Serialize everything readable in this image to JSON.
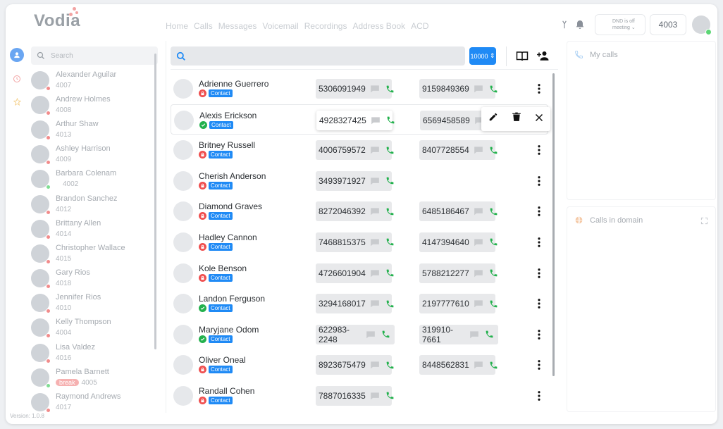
{
  "app": {
    "logo": "Vodia",
    "version": "Version: 1.0.8"
  },
  "nav": [
    "Home",
    "Calls",
    "Messages",
    "Voicemail",
    "Recordings",
    "Address Book",
    "ACD"
  ],
  "header": {
    "dnd_status": "DND is off",
    "dnd_mode": "meeting",
    "extension": "4003"
  },
  "sidebar": {
    "search_placeholder": "Search",
    "users": [
      {
        "name": "Alexander Aguilar",
        "ext": "4007",
        "status": "red"
      },
      {
        "name": "Andrew Holmes",
        "ext": "4008",
        "status": "red"
      },
      {
        "name": "Arthur Shaw",
        "ext": "4013",
        "status": "red"
      },
      {
        "name": "Ashley Harrison",
        "ext": "4009",
        "status": "red"
      },
      {
        "name": "Barbara Colenam",
        "ext": "4002",
        "status": "green"
      },
      {
        "name": "Brandon Sanchez",
        "ext": "4012",
        "status": "red"
      },
      {
        "name": "Brittany Allen",
        "ext": "4014",
        "status": "red"
      },
      {
        "name": "Christopher Wallace",
        "ext": "4015",
        "status": "red"
      },
      {
        "name": "Gary Rios",
        "ext": "4018",
        "status": "red"
      },
      {
        "name": "Jennifer Rios",
        "ext": "4010",
        "status": "red"
      },
      {
        "name": "Kelly Thompson",
        "ext": "4004",
        "status": "red"
      },
      {
        "name": "Lisa Valdez",
        "ext": "4016",
        "status": "red"
      },
      {
        "name": "Pamela Barnett",
        "ext": "4005",
        "status": "green",
        "badge": "break"
      },
      {
        "name": "Raymond Andrews",
        "ext": "4017",
        "status": "red"
      }
    ]
  },
  "main": {
    "search_placeholder": "",
    "dropdown_value": "10000",
    "contacts": [
      {
        "name": "Adrienne Guerrero",
        "lock": "red",
        "tag": "Contact",
        "n1": "5306091949",
        "n2": "9159849369"
      },
      {
        "name": "Alexis Erickson",
        "lock": "green",
        "tag": "Contact",
        "n1": "4928327425",
        "n2": "6569458589"
      },
      {
        "name": "Britney Russell",
        "lock": "red",
        "tag": "Contact",
        "n1": "4006759572",
        "n2": "8407728554"
      },
      {
        "name": "Cherish Anderson",
        "lock": "red",
        "tag": "Contact",
        "n1": "3493971927",
        "n2": ""
      },
      {
        "name": "Diamond Graves",
        "lock": "red",
        "tag": "Contact",
        "n1": "8272046392",
        "n2": "6485186467"
      },
      {
        "name": "Hadley Cannon",
        "lock": "red",
        "tag": "Contact",
        "n1": "7468815375",
        "n2": "4147394640"
      },
      {
        "name": "Kole Benson",
        "lock": "red",
        "tag": "Contact",
        "n1": "4726601904",
        "n2": "5788212277"
      },
      {
        "name": "Landon Ferguson",
        "lock": "green",
        "tag": "Contact",
        "n1": "3294168017",
        "n2": "2197777610"
      },
      {
        "name": "Maryjane Odom",
        "lock": "green",
        "tag": "Contact",
        "n1": "622983-2248",
        "n2": "319910-7661"
      },
      {
        "name": "Oliver Oneal",
        "lock": "red",
        "tag": "Contact",
        "n1": "8923675479",
        "n2": "8448562831"
      },
      {
        "name": "Randall Cohen",
        "lock": "red",
        "tag": "Contact",
        "n1": "7887016335",
        "n2": ""
      }
    ]
  },
  "panels": {
    "my_calls": "My calls",
    "calls_in_domain": "Calls in domain"
  },
  "colors": {
    "accent": "#1f8af5",
    "call_green": "#23b14d",
    "lock_red": "#ef4f4f"
  },
  "icons": [
    "search-icon",
    "book-icon",
    "add-contact-icon",
    "chat-icon",
    "phone-icon",
    "edit-icon",
    "trash-icon",
    "close-icon",
    "more-vertical-icon",
    "bell-icon",
    "star-icon",
    "clock-icon",
    "user-icon",
    "fullscreen-icon",
    "globe-icon"
  ]
}
